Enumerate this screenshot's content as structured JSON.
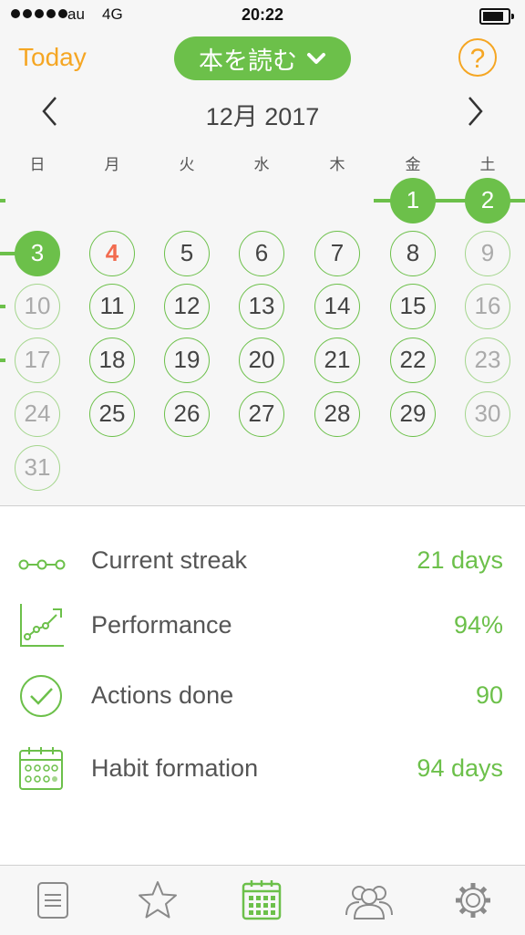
{
  "status_bar": {
    "carrier": "au",
    "network": "4G",
    "time": "20:22"
  },
  "header": {
    "today_label": "Today",
    "habit_name": "本を読む",
    "help_label": "?"
  },
  "calendar": {
    "month_label": "12月 2017",
    "weekdays": [
      "日",
      "月",
      "火",
      "水",
      "木",
      "金",
      "土"
    ],
    "days": [
      "1",
      "2",
      "3",
      "4",
      "5",
      "6",
      "7",
      "8",
      "9",
      "10",
      "11",
      "12",
      "13",
      "14",
      "15",
      "16",
      "17",
      "18",
      "19",
      "20",
      "21",
      "22",
      "23",
      "24",
      "25",
      "26",
      "27",
      "28",
      "29",
      "30",
      "31"
    ],
    "done_days": [
      1,
      2,
      3
    ],
    "today": 4
  },
  "stats": [
    {
      "label": "Current streak",
      "value": "21 days",
      "icon": "streak-icon"
    },
    {
      "label": "Performance",
      "value": "94%",
      "icon": "performance-chart-icon"
    },
    {
      "label": "Actions done",
      "value": "90",
      "icon": "check-circle-icon"
    },
    {
      "label": "Habit formation",
      "value": "94 days",
      "icon": "calendar-grid-icon"
    }
  ],
  "tabbar": {
    "items": [
      "notes-tab",
      "favorites-tab",
      "calendar-tab",
      "community-tab",
      "settings-tab"
    ],
    "active": "calendar-tab"
  },
  "colors": {
    "accent_green": "#6cc04a",
    "accent_orange": "#f5a623",
    "today_red": "#f26b4f"
  }
}
